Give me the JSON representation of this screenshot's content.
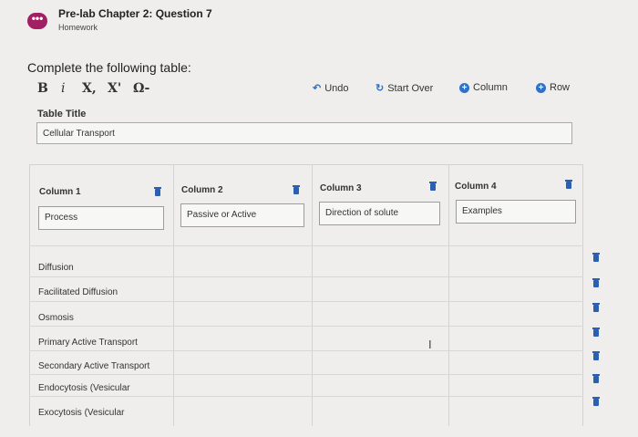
{
  "header": {
    "menu_icon": "ellipsis-icon",
    "title": "Pre-lab Chapter 2: Question 7",
    "subtitle": "Homework"
  },
  "prompt": "Complete the following table:",
  "toolbar": {
    "bold": "B",
    "italic": "i",
    "subscript": "X,",
    "superscript": "X'",
    "special_chars": "Ω-",
    "undo_label": "Undo",
    "start_over_label": "Start Over",
    "add_column_label": "Column",
    "add_row_label": "Row"
  },
  "table_title": {
    "label": "Table Title",
    "value": "Cellular Transport"
  },
  "columns": [
    {
      "header": "Column 1",
      "value": "Process"
    },
    {
      "header": "Column 2",
      "value": "Passive or Active"
    },
    {
      "header": "Column 3",
      "value": "Direction of solute"
    },
    {
      "header": "Column 4",
      "value": "Examples"
    }
  ],
  "rows": [
    "Diffusion",
    "Facilitated Diffusion",
    "Osmosis",
    "Primary Active Transport",
    "Secondary Active Transport",
    "Endocytosis (Vesicular",
    "Exocytosis (Vesicular"
  ],
  "colors": {
    "accent": "#2f72c8",
    "trash": "#2a5fb1",
    "menu": "#a21f63"
  }
}
